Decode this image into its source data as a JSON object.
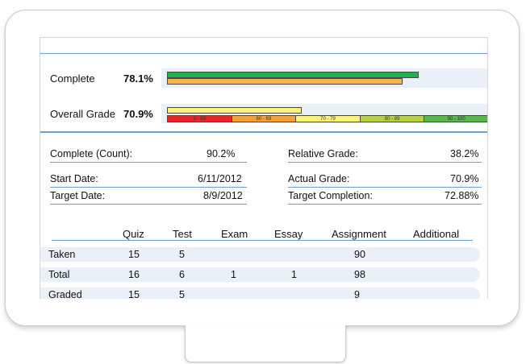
{
  "progress": {
    "complete": {
      "label": "Complete",
      "value": "78.1%",
      "fill": 0.781,
      "bar2_fill": 0.71
    },
    "overall": {
      "label": "Overall Grade",
      "value": "70.9%",
      "fill": 0.709
    }
  },
  "grade_scale": [
    {
      "label": "0 - 59",
      "color": "#e8262a"
    },
    {
      "label": "60 - 69",
      "color": "#f5a03c"
    },
    {
      "label": "70 - 79",
      "color": "#fff27a"
    },
    {
      "label": "80 - 89",
      "color": "#b8cf4a"
    },
    {
      "label": "90 - 100",
      "color": "#58b84a"
    }
  ],
  "details": {
    "complete_count_label": "Complete (Count):",
    "complete_count_value": "90.2%",
    "start_date_label": "Start Date:",
    "start_date_value": "6/11/2012",
    "target_date_label": "Target Date:",
    "target_date_value": "8/9/2012",
    "relative_grade_label": "Relative Grade:",
    "relative_grade_value": "38.2%",
    "actual_grade_label": "Actual Grade:",
    "actual_grade_value": "70.9%",
    "target_completion_label": "Target Completion:",
    "target_completion_value": "72.88%"
  },
  "table": {
    "headers": [
      "Quiz",
      "Test",
      "Exam",
      "Essay",
      "Assignment",
      "Additional"
    ],
    "rows": [
      {
        "label": "Taken",
        "cells": [
          "15",
          "5",
          "",
          "",
          "90",
          ""
        ]
      },
      {
        "label": "Total",
        "cells": [
          "16",
          "6",
          "1",
          "1",
          "98",
          ""
        ]
      },
      {
        "label": "Graded",
        "cells": [
          "15",
          "5",
          "",
          "",
          "9",
          ""
        ]
      }
    ]
  }
}
